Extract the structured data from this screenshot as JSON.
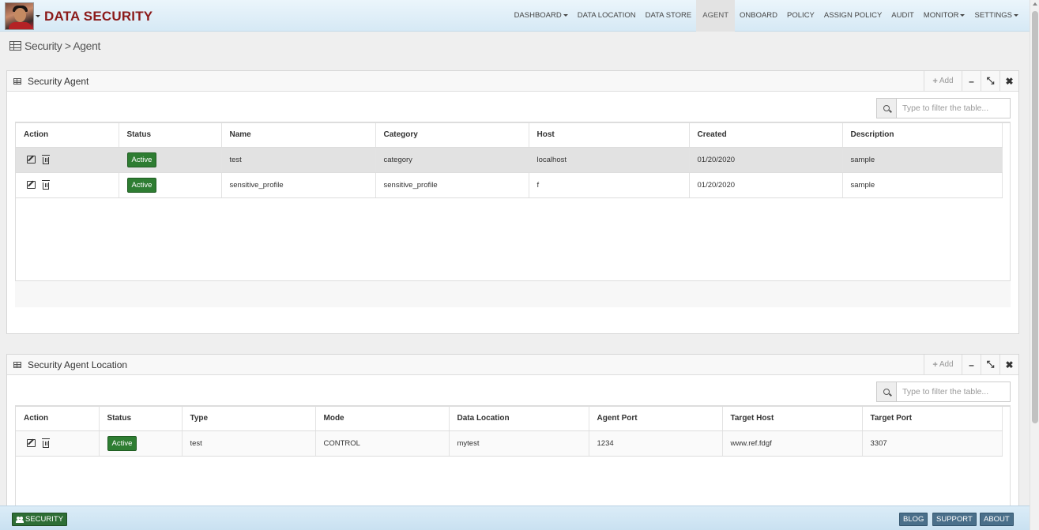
{
  "header": {
    "title": "DATA SECURITY",
    "nav": [
      {
        "label": "DASHBOARD",
        "dropdown": true
      },
      {
        "label": "DATA LOCATION",
        "dropdown": false
      },
      {
        "label": "DATA STORE",
        "dropdown": false
      },
      {
        "label": "AGENT",
        "dropdown": false,
        "active": true
      },
      {
        "label": "ONBOARD",
        "dropdown": false
      },
      {
        "label": "POLICY",
        "dropdown": false
      },
      {
        "label": "ASSIGN POLICY",
        "dropdown": false
      },
      {
        "label": "AUDIT",
        "dropdown": false
      },
      {
        "label": "MONITOR",
        "dropdown": true
      },
      {
        "label": "SETTINGS",
        "dropdown": true
      }
    ]
  },
  "breadcrumb": "Security > Agent",
  "panel_agent": {
    "title": "Security Agent",
    "add_label": "Add",
    "filter_placeholder": "Type to filter the table...",
    "columns": [
      "Action",
      "Status",
      "Name",
      "Category",
      "Host",
      "Created",
      "Description"
    ],
    "rows": [
      {
        "status": "Active",
        "name": "test",
        "category": "category",
        "host": "localhost",
        "created": "01/20/2020",
        "description": "sample"
      },
      {
        "status": "Active",
        "name": "sensitive_profile",
        "category": "sensitive_profile",
        "host": "f",
        "created": "01/20/2020",
        "description": "sample"
      }
    ]
  },
  "panel_location": {
    "title": "Security Agent Location",
    "add_label": "Add",
    "filter_placeholder": "Type to filter the table...",
    "columns": [
      "Action",
      "Status",
      "Type",
      "Mode",
      "Data Location",
      "Agent Port",
      "Target Host",
      "Target Port"
    ],
    "rows": [
      {
        "status": "Active",
        "type": "test",
        "mode": "CONTROL",
        "data_location": "mytest",
        "agent_port": "1234",
        "target_host": "www.ref.fdgf",
        "target_port": "3307"
      }
    ]
  },
  "footer": {
    "security_label": "SECURITY",
    "blog_label": "BLOG",
    "support_label": "SUPPORT",
    "about_label": "ABOUT"
  },
  "colors": {
    "title_red": "#8b1a1a",
    "badge_green": "#2e7d32",
    "footer_button_blue": "#4a6f8a"
  }
}
